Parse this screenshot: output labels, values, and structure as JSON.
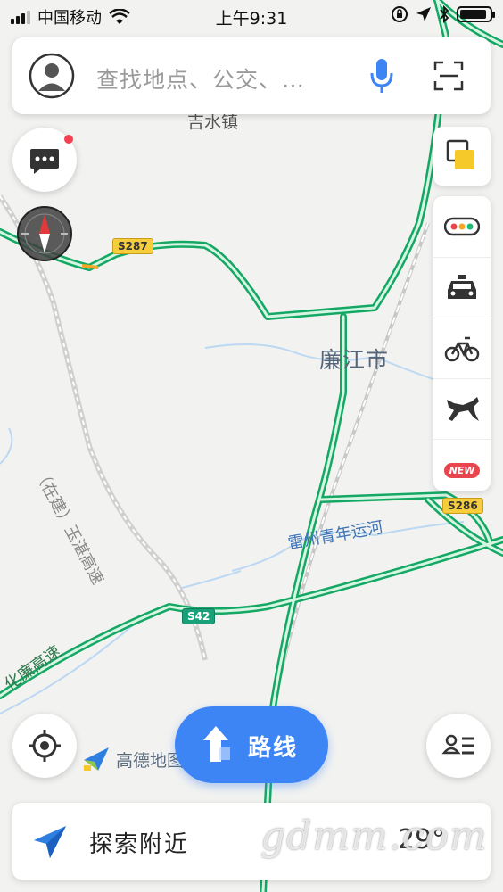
{
  "status_bar": {
    "carrier": "中国移动",
    "time": "上午9:31",
    "battery_level": 0.9
  },
  "search": {
    "placeholder": "查找地点、公交、…",
    "icons": [
      "avatar-icon",
      "microphone-icon",
      "scan-icon"
    ]
  },
  "map": {
    "city_label": "廉江市",
    "town_label": "吉水镇",
    "river_label": "雷州青年运河",
    "highway_label": "化廉高速",
    "planned_highway_label": "（在建）玉湛高速",
    "road_shields": [
      "S287",
      "S286",
      "S42"
    ]
  },
  "side_tools": {
    "layers_icon": "layers-icon",
    "items": [
      {
        "name": "traffic-icon"
      },
      {
        "name": "taxi-icon"
      },
      {
        "name": "bike-icon"
      },
      {
        "name": "horse-icon"
      },
      {
        "name": "new-badge",
        "label": "NEW"
      }
    ]
  },
  "bottom": {
    "logo_text": "高德地图",
    "route_label": "路线",
    "explore_label": "探索附近",
    "temperature": "29°",
    "watermark": "gdmm.com"
  },
  "colors": {
    "road_green": "#1db874",
    "accent_blue": "#3d85f5",
    "badge_red": "#e8454e",
    "shield_yellow": "#f6cd3c"
  }
}
